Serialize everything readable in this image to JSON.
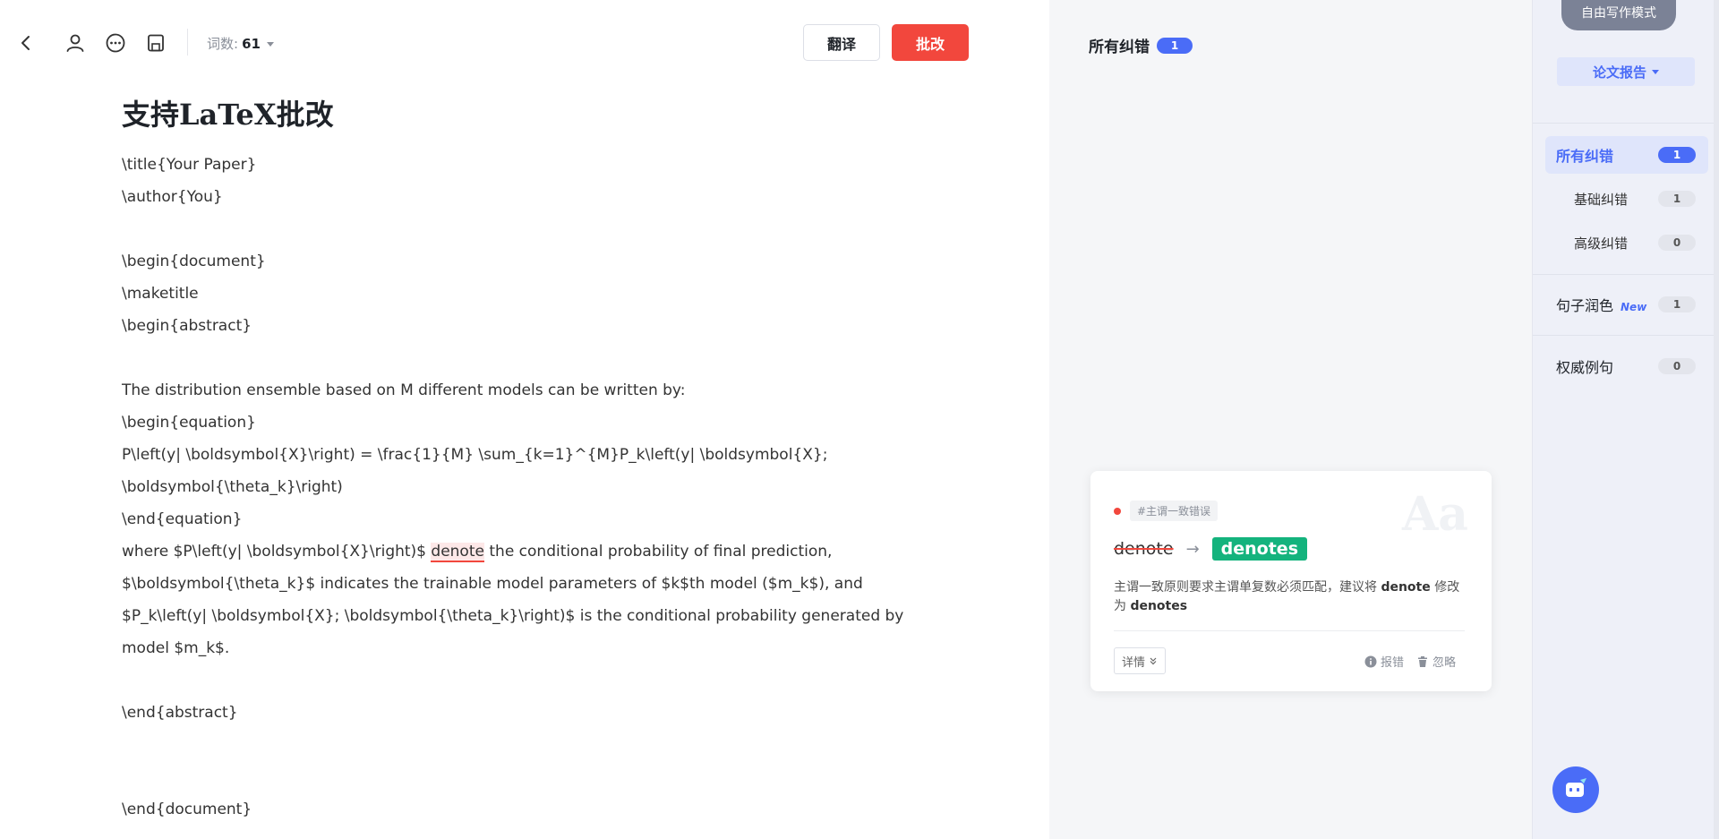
{
  "toolbar": {
    "word_count_label": "词数:",
    "word_count_value": "61",
    "translate_label": "翻译",
    "correct_label": "批改"
  },
  "document": {
    "title": "支持LaTeX批改",
    "lines": [
      "\\title{Your Paper}",
      "\\author{You}",
      "",
      "\\begin{document}",
      "\\maketitle",
      "\\begin{abstract}",
      "",
      "The distribution ensemble based on M different models can be written by:",
      "\\begin{equation}",
      "P\\left(y| \\boldsymbol{X}\\right) = \\frac{1}{M} \\sum_{k=1}^{M}P_k\\left(y| \\boldsymbol{X};",
      "\\boldsymbol{\\theta_k}\\right)",
      "\\end{equation}",
      "",
      "$\\boldsymbol{\\theta_k}$ indicates the trainable model parameters of $k$th model ($m_k$), and",
      "$P_k\\left(y| \\boldsymbol{X}; \\boldsymbol{\\theta_k}\\right)$ is the conditional probability generated by",
      "model $m_k$.",
      "",
      "\\end{abstract}",
      "",
      "",
      "\\end{document}"
    ],
    "error_line": {
      "before": "where $P\\left(y| \\boldsymbol{X}\\right)$ ",
      "highlight": "denote",
      "after": " the conditional probability of final prediction,"
    }
  },
  "middle": {
    "header_label": "所有纠错",
    "header_count": "1",
    "card": {
      "watermark": "Aa",
      "tag": "#主谓一致错误",
      "wrong_word": "denote",
      "arrow": "→",
      "right_word": "denotes",
      "explain_prefix": "主谓一致原则要求主谓单复数必须匹配，建议将 ",
      "explain_word1": "denote",
      "explain_middle": " 修改为 ",
      "explain_word2": "denotes",
      "detail_label": "详情",
      "report_label": "报错",
      "ignore_label": "忽略"
    }
  },
  "sidebar": {
    "mode_label": "自由写作模式",
    "report_label": "论文报告",
    "items": [
      {
        "label": "所有纠错",
        "count": "1"
      },
      {
        "label": "基础纠错",
        "count": "1"
      },
      {
        "label": "高级纠错",
        "count": "0"
      },
      {
        "label": "句子润色",
        "new_tag": "New",
        "count": "1"
      },
      {
        "label": "权威例句",
        "count": "0"
      }
    ]
  },
  "colors": {
    "accent": "#4a6cf7",
    "danger": "#f2473d",
    "success": "#14b37d"
  }
}
